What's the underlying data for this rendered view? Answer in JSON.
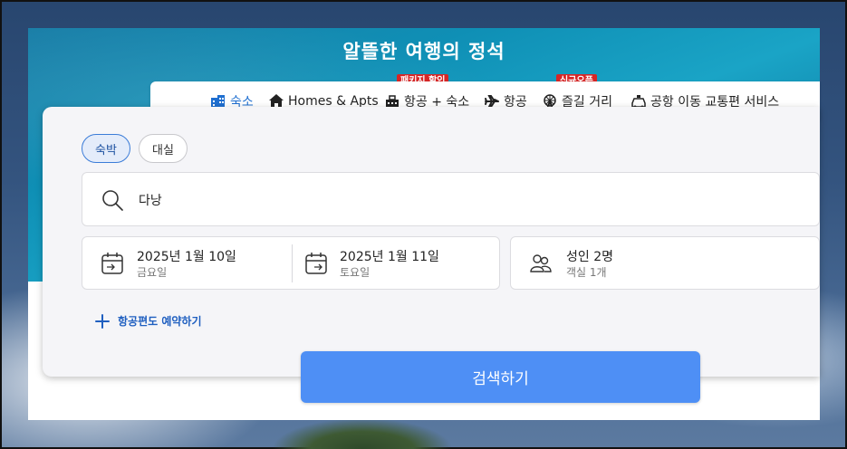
{
  "hero": {
    "title": "알뜰한 여행의 정석"
  },
  "tabs": [
    {
      "label": "숙소",
      "icon": "hotel-icon",
      "active": true
    },
    {
      "label": "Homes & Apts",
      "icon": "home-icon",
      "active": false
    },
    {
      "label": "항공 + 숙소",
      "icon": "package-icon",
      "active": false,
      "badge": "패키지 할인"
    },
    {
      "label": "항공",
      "icon": "airplane-icon",
      "active": false
    },
    {
      "label": "즐길 거리",
      "icon": "ferris-wheel-icon",
      "active": false,
      "badge": "신규오픈"
    },
    {
      "label": "공항 이동 교통편 서비스",
      "icon": "car-icon",
      "active": false
    }
  ],
  "stay_type": {
    "options": [
      "숙박",
      "대실"
    ],
    "selected": "숙박"
  },
  "destination": {
    "value": "다낭",
    "icon": "search-icon"
  },
  "checkin": {
    "date": "2025년 1월 10일",
    "weekday": "금요일",
    "icon": "calendar-checkin-icon"
  },
  "checkout": {
    "date": "2025년 1월 11일",
    "weekday": "토요일",
    "icon": "calendar-checkout-icon"
  },
  "guests": {
    "main": "성인 2명",
    "sub": "객실 1개",
    "icon": "people-icon"
  },
  "add_flight": {
    "label": "항공편도 예약하기",
    "icon": "plus-icon"
  },
  "search_button": {
    "label": "검색하기"
  },
  "colors": {
    "accent": "#2b7be0",
    "button": "#4e8ff5",
    "badge": "#d82626"
  }
}
